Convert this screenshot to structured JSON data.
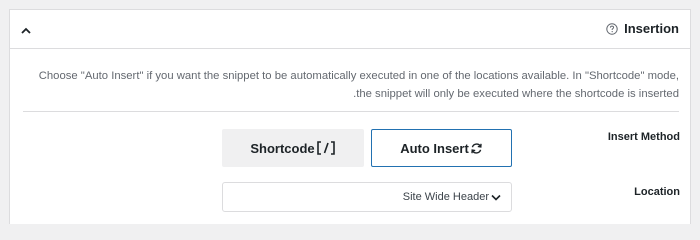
{
  "panel": {
    "title": "Insertion",
    "description": "Choose \"Auto Insert\" if you want the snippet to be automatically executed in one of the locations available. In \"Shortcode\" mode, the snippet will only be executed where the shortcode is inserted."
  },
  "insert_method": {
    "label": "Insert Method",
    "shortcode_label": "Shortcode",
    "shortcode_glyph": "[/]",
    "auto_insert_label": "Auto Insert",
    "selected": "Auto Insert"
  },
  "location": {
    "label": "Location",
    "value": "Site Wide Header"
  },
  "colors": {
    "accent": "#2271b1",
    "panel_bg": "#ffffff",
    "page_bg": "#f0f0f1"
  },
  "icons": [
    "chevron-up-icon",
    "help-icon",
    "shortcode-icon",
    "sync-icon",
    "chevron-down-icon"
  ]
}
